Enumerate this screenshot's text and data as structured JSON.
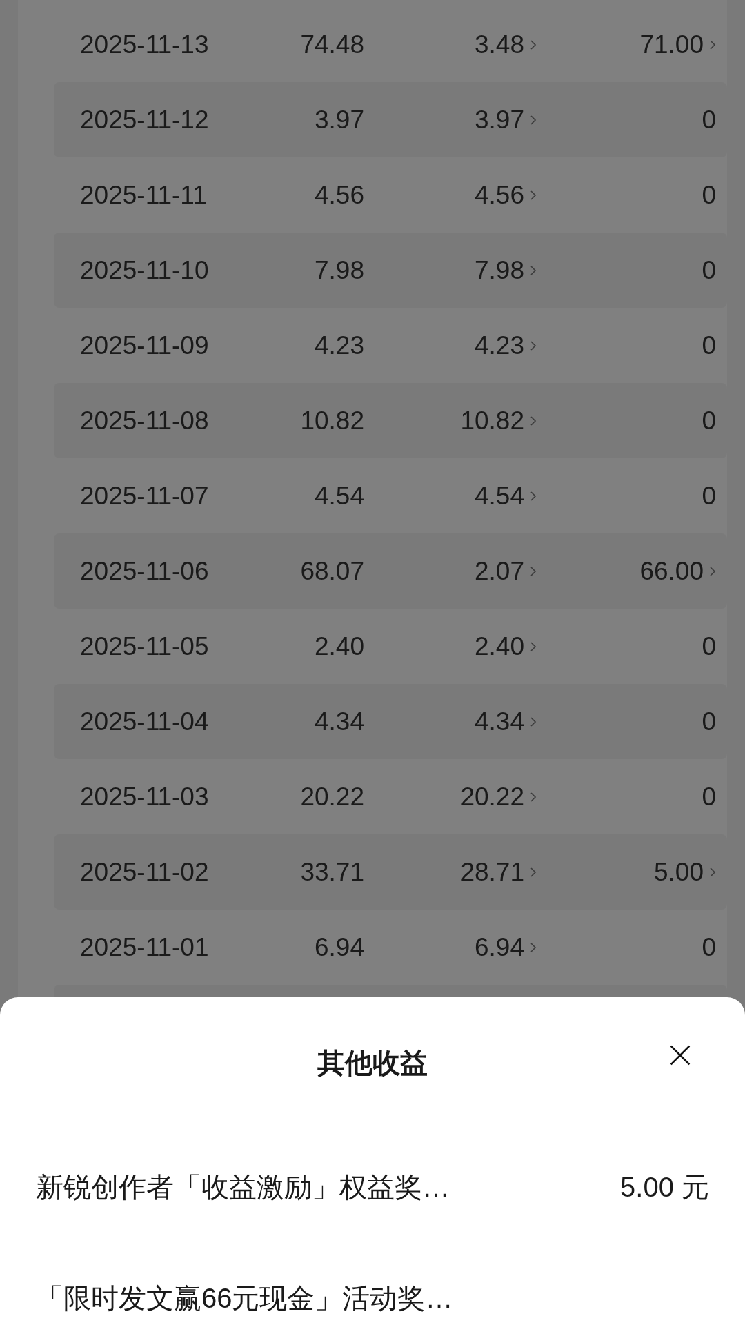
{
  "table": {
    "rows": [
      {
        "date": "2025-11-13",
        "column_2": "74.48",
        "column_3": {
          "value": "3.48",
          "has_detail": true
        },
        "column_4": {
          "value": "71.00",
          "has_detail": true
        }
      },
      {
        "date": "2025-11-12",
        "column_2": "3.97",
        "column_3": {
          "value": "3.97",
          "has_detail": true
        },
        "column_4": {
          "value": "0",
          "has_detail": false
        }
      },
      {
        "date": "2025-11-11",
        "column_2": "4.56",
        "column_3": {
          "value": "4.56",
          "has_detail": true
        },
        "column_4": {
          "value": "0",
          "has_detail": false
        }
      },
      {
        "date": "2025-11-10",
        "column_2": "7.98",
        "column_3": {
          "value": "7.98",
          "has_detail": true
        },
        "column_4": {
          "value": "0",
          "has_detail": false
        }
      },
      {
        "date": "2025-11-09",
        "column_2": "4.23",
        "column_3": {
          "value": "4.23",
          "has_detail": true
        },
        "column_4": {
          "value": "0",
          "has_detail": false
        }
      },
      {
        "date": "2025-11-08",
        "column_2": "10.82",
        "column_3": {
          "value": "10.82",
          "has_detail": true
        },
        "column_4": {
          "value": "0",
          "has_detail": false
        }
      },
      {
        "date": "2025-11-07",
        "column_2": "4.54",
        "column_3": {
          "value": "4.54",
          "has_detail": true
        },
        "column_4": {
          "value": "0",
          "has_detail": false
        }
      },
      {
        "date": "2025-11-06",
        "column_2": "68.07",
        "column_3": {
          "value": "2.07",
          "has_detail": true
        },
        "column_4": {
          "value": "66.00",
          "has_detail": true
        }
      },
      {
        "date": "2025-11-05",
        "column_2": "2.40",
        "column_3": {
          "value": "2.40",
          "has_detail": true
        },
        "column_4": {
          "value": "0",
          "has_detail": false
        }
      },
      {
        "date": "2025-11-04",
        "column_2": "4.34",
        "column_3": {
          "value": "4.34",
          "has_detail": true
        },
        "column_4": {
          "value": "0",
          "has_detail": false
        }
      },
      {
        "date": "2025-11-03",
        "column_2": "20.22",
        "column_3": {
          "value": "20.22",
          "has_detail": true
        },
        "column_4": {
          "value": "0",
          "has_detail": false
        }
      },
      {
        "date": "2025-11-02",
        "column_2": "33.71",
        "column_3": {
          "value": "28.71",
          "has_detail": true
        },
        "column_4": {
          "value": "5.00",
          "has_detail": true
        }
      },
      {
        "date": "2025-11-01",
        "column_2": "6.94",
        "column_3": {
          "value": "6.94",
          "has_detail": true
        },
        "column_4": {
          "value": "0",
          "has_detail": false
        }
      }
    ]
  },
  "sheet": {
    "title": "其他收益",
    "items": [
      {
        "name": "新锐创作者「收益激励」权益奖…",
        "amount": "5.00 元"
      },
      {
        "name": "「限时发文赢66元现金」活动奖…"
      }
    ]
  }
}
